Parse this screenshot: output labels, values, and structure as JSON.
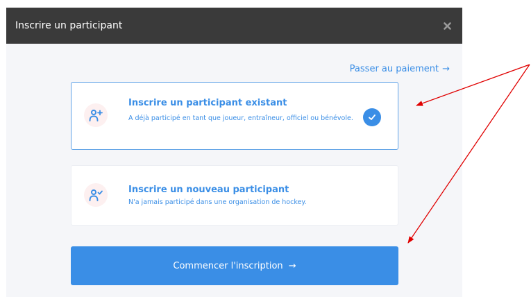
{
  "dialog": {
    "title": "Inscrire un participant",
    "close_icon": "close-icon",
    "skip_link": {
      "label": "Passer au paiement",
      "arrow": "→"
    },
    "options": [
      {
        "title": "Inscrire un participant existant",
        "description": "A déjà participé en tant que joueur, entraîneur, officiel ou bénévole.",
        "icon": "user-plus-icon",
        "selected": true
      },
      {
        "title": "Inscrire un nouveau participant",
        "description": "N'a jamais participé dans une organisation de hockey.",
        "icon": "user-check-icon",
        "selected": false
      }
    ],
    "start_button": {
      "label": "Commencer l'inscription",
      "arrow": "→"
    }
  },
  "colors": {
    "header_bg": "#3a3a3a",
    "accent": "#3a8ee6",
    "body_bg": "#f5f6f9",
    "icon_bg": "#fdf0f0",
    "annotation": "#e00000"
  }
}
